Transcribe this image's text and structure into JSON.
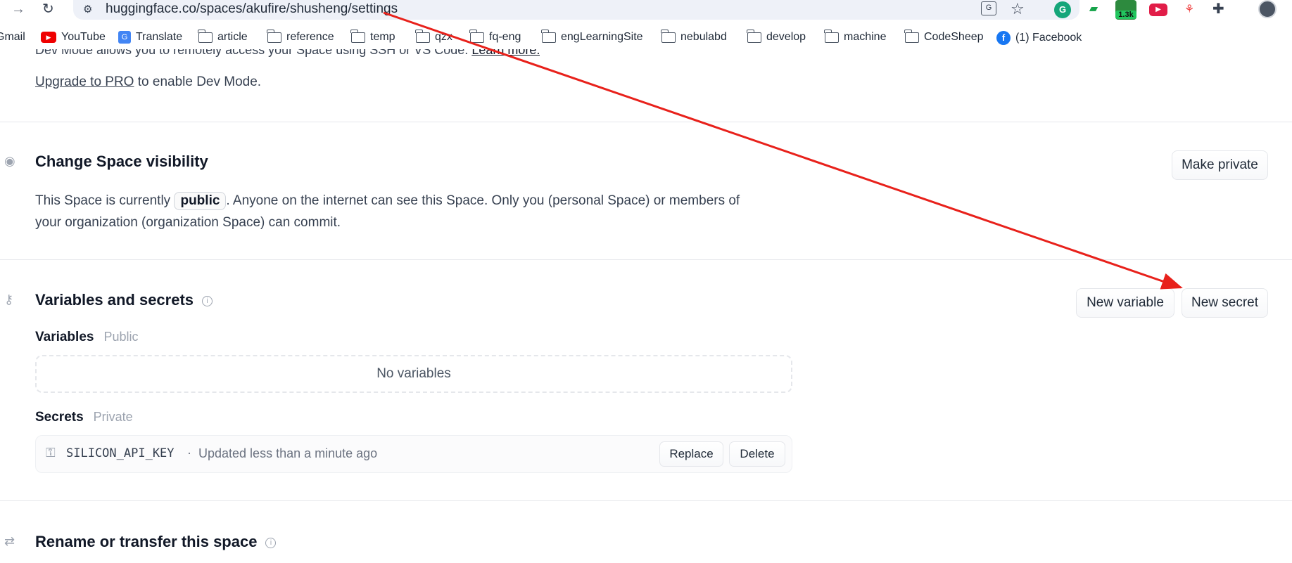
{
  "browser": {
    "url": "huggingface.co/spaces/akufire/shusheng/settings",
    "extension_badge": "1.3k",
    "bookmarks": [
      {
        "label": "Gmail",
        "icon": "none"
      },
      {
        "label": "YouTube",
        "icon": "youtube-icon"
      },
      {
        "label": "Translate",
        "icon": "translate-icon"
      },
      {
        "label": "article",
        "icon": "folder-icon"
      },
      {
        "label": "reference",
        "icon": "folder-icon"
      },
      {
        "label": "temp",
        "icon": "folder-icon"
      },
      {
        "label": "qzx",
        "icon": "folder-icon"
      },
      {
        "label": "fq-eng",
        "icon": "folder-icon"
      },
      {
        "label": "engLearningSite",
        "icon": "folder-icon"
      },
      {
        "label": "nebulabd",
        "icon": "folder-icon"
      },
      {
        "label": "develop",
        "icon": "folder-icon"
      },
      {
        "label": "machine",
        "icon": "folder-icon"
      },
      {
        "label": "CodeSheep",
        "icon": "folder-icon"
      },
      {
        "label": "(1) Facebook",
        "icon": "facebook-icon"
      }
    ]
  },
  "dev_mode": {
    "cut_text": "Dev Mode allows you to remotely access your Space using SSH or VS Code.",
    "learn_more": "Learn more.",
    "upgrade_link": "Upgrade to PRO",
    "upgrade_suffix": " to enable Dev Mode."
  },
  "visibility": {
    "title": "Change Space visibility",
    "button": "Make private",
    "text_before": "This Space is currently ",
    "status": "public",
    "text_after": ". Anyone on the internet can see this Space. Only you (personal Space) or members of your organization (organization Space) can commit."
  },
  "variables_secrets": {
    "title": "Variables and secrets",
    "new_variable_button": "New variable",
    "new_secret_button": "New secret",
    "variables_label": "Variables",
    "variables_scope": "Public",
    "variables_empty": "No variables",
    "secrets_label": "Secrets",
    "secrets_scope": "Private",
    "secrets": [
      {
        "name": "SILICON_API_KEY",
        "separator": "·",
        "updated": "Updated less than a minute ago",
        "replace_label": "Replace",
        "delete_label": "Delete"
      }
    ]
  },
  "rename": {
    "title": "Rename or transfer this space"
  },
  "annotation": {
    "arrow_color": "#e8211b"
  },
  "colors": {
    "omnibox_bg": "#eef1f8",
    "divider": "#e5e7eb",
    "muted_text": "#9ca3af"
  }
}
